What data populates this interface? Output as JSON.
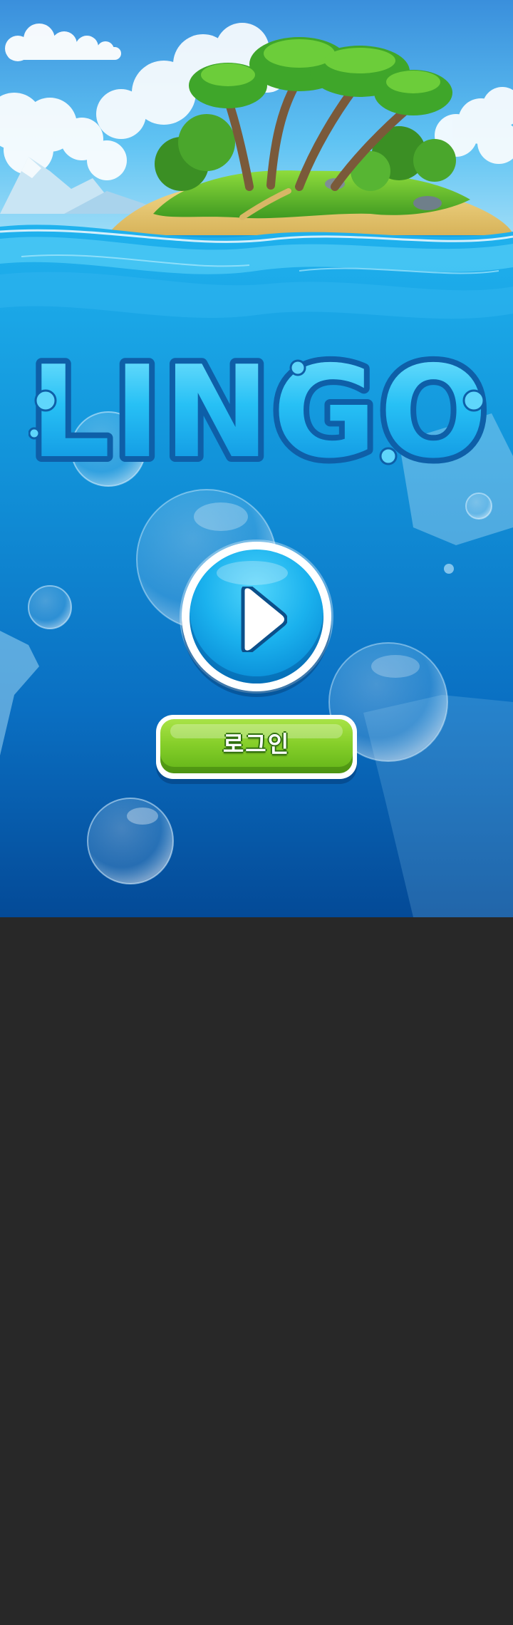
{
  "game": {
    "logo_text": "LINGO",
    "login_label": "로그인"
  },
  "icons": {
    "play": "play-icon"
  },
  "colors": {
    "logo_fill": "#27c0f5",
    "logo_outline": "#0e5fa8",
    "play_button": "#1bb2ee",
    "login_button": "#86cf2a",
    "sea_deep": "#044a97",
    "sky": "#43b6f1",
    "below_fold": "#282828"
  }
}
